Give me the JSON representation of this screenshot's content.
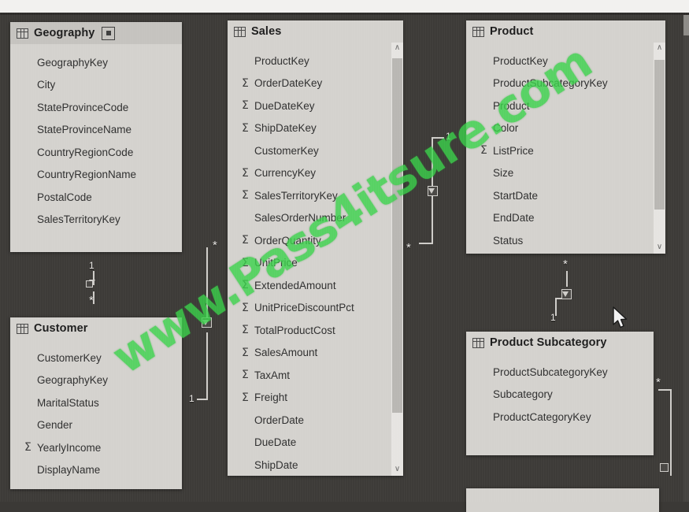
{
  "app": {
    "view": "model-relationship-diagram",
    "background_color": "#3d3b38",
    "card_color": "#d4d2ce",
    "header_color": "#c5c3bf",
    "watermark": "www.Pass4itsure.com",
    "watermark_color": "#3ad24a"
  },
  "tables": [
    {
      "id": "geography",
      "title": "Geography",
      "grid_icon": "table-icon",
      "expand_icon": "expand-table-icon",
      "has_expand_icon": true,
      "has_scrollbar": false,
      "fields": [
        {
          "name": "GeographyKey",
          "aggregate": false
        },
        {
          "name": "City",
          "aggregate": false
        },
        {
          "name": "StateProvinceCode",
          "aggregate": false
        },
        {
          "name": "StateProvinceName",
          "aggregate": false
        },
        {
          "name": "CountryRegionCode",
          "aggregate": false
        },
        {
          "name": "CountryRegionName",
          "aggregate": false
        },
        {
          "name": "PostalCode",
          "aggregate": false
        },
        {
          "name": "SalesTerritoryKey",
          "aggregate": false
        }
      ]
    },
    {
      "id": "sales",
      "title": "Sales",
      "grid_icon": "table-icon",
      "has_expand_icon": false,
      "has_scrollbar": true,
      "fields": [
        {
          "name": "ProductKey",
          "aggregate": false
        },
        {
          "name": "OrderDateKey",
          "aggregate": true
        },
        {
          "name": "DueDateKey",
          "aggregate": true
        },
        {
          "name": "ShipDateKey",
          "aggregate": true
        },
        {
          "name": "CustomerKey",
          "aggregate": false
        },
        {
          "name": "CurrencyKey",
          "aggregate": true
        },
        {
          "name": "SalesTerritoryKey",
          "aggregate": true
        },
        {
          "name": "SalesOrderNumber",
          "aggregate": false
        },
        {
          "name": "OrderQuantity",
          "aggregate": true
        },
        {
          "name": "UnitPrice",
          "aggregate": true
        },
        {
          "name": "ExtendedAmount",
          "aggregate": true
        },
        {
          "name": "UnitPriceDiscountPct",
          "aggregate": true
        },
        {
          "name": "TotalProductCost",
          "aggregate": true
        },
        {
          "name": "SalesAmount",
          "aggregate": true
        },
        {
          "name": "TaxAmt",
          "aggregate": true
        },
        {
          "name": "Freight",
          "aggregate": true
        },
        {
          "name": "OrderDate",
          "aggregate": false
        },
        {
          "name": "DueDate",
          "aggregate": false
        },
        {
          "name": "ShipDate",
          "aggregate": false
        }
      ]
    },
    {
      "id": "product",
      "title": "Product",
      "grid_icon": "table-icon",
      "has_expand_icon": false,
      "has_scrollbar": true,
      "fields": [
        {
          "name": "ProductKey",
          "aggregate": false
        },
        {
          "name": "ProductSubcategoryKey",
          "aggregate": false
        },
        {
          "name": "Product",
          "aggregate": false
        },
        {
          "name": "Color",
          "aggregate": false
        },
        {
          "name": "ListPrice",
          "aggregate": true
        },
        {
          "name": "Size",
          "aggregate": false
        },
        {
          "name": "StartDate",
          "aggregate": false
        },
        {
          "name": "EndDate",
          "aggregate": false
        },
        {
          "name": "Status",
          "aggregate": false
        }
      ]
    },
    {
      "id": "customer",
      "title": "Customer",
      "grid_icon": "table-icon",
      "has_expand_icon": false,
      "has_scrollbar": false,
      "fields": [
        {
          "name": "CustomerKey",
          "aggregate": false
        },
        {
          "name": "GeographyKey",
          "aggregate": false
        },
        {
          "name": "MaritalStatus",
          "aggregate": false
        },
        {
          "name": "Gender",
          "aggregate": false
        },
        {
          "name": "YearlyIncome",
          "aggregate": true
        },
        {
          "name": "DisplayName",
          "aggregate": false
        }
      ]
    },
    {
      "id": "product-subcategory",
      "title": "Product Subcategory",
      "grid_icon": "table-icon",
      "has_expand_icon": false,
      "has_scrollbar": false,
      "fields": [
        {
          "name": "ProductSubcategoryKey",
          "aggregate": false
        },
        {
          "name": "Subcategory",
          "aggregate": false
        },
        {
          "name": "ProductCategoryKey",
          "aggregate": false
        }
      ]
    }
  ],
  "relationships": [
    {
      "id": "geography-customer",
      "from": "Geography",
      "to": "Customer",
      "from_cardinality": "1",
      "to_cardinality": "*",
      "cross_filter": "single"
    },
    {
      "id": "customer-sales",
      "from": "Sales",
      "to": "Customer",
      "from_cardinality": "*",
      "to_cardinality": "1",
      "cross_filter": "single"
    },
    {
      "id": "sales-product",
      "from": "Product",
      "to": "Sales",
      "from_cardinality": "1",
      "to_cardinality": "*",
      "cross_filter": "single"
    },
    {
      "id": "product-subcategory-product",
      "from": "Product",
      "to": "Product Subcategory",
      "from_cardinality": "*",
      "to_cardinality": "1",
      "cross_filter": "single"
    },
    {
      "id": "subcategory-offscreen",
      "from": "Product Subcategory",
      "to": "",
      "from_cardinality": "*",
      "to_cardinality": "",
      "cross_filter": "single"
    }
  ],
  "symbols": {
    "many": "*",
    "one": "1",
    "sigma": "Σ",
    "scroll_up": "∧",
    "scroll_down": "∨"
  }
}
